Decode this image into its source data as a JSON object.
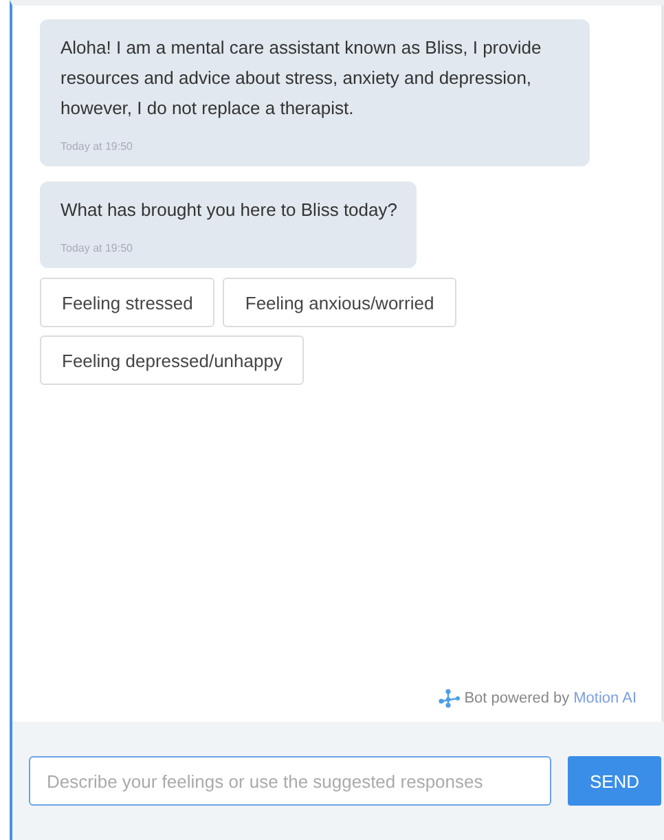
{
  "messages": [
    {
      "text": "Aloha! I am a mental care assistant known as Bliss, I provide resources and advice about stress, anxiety and depression, however, I do not replace a therapist.",
      "time": "Today at 19:50"
    },
    {
      "text": "What has brought you here to Bliss today?",
      "time": "Today at 19:50"
    }
  ],
  "quick_replies": [
    "Feeling stressed",
    "Feeling anxious/worried",
    "Feeling depressed/unhappy"
  ],
  "branding": {
    "prefix": "Bot powered by",
    "link": "Motion AI"
  },
  "composer": {
    "placeholder": "Describe your feelings or use the suggested responses",
    "button": "SEND"
  }
}
